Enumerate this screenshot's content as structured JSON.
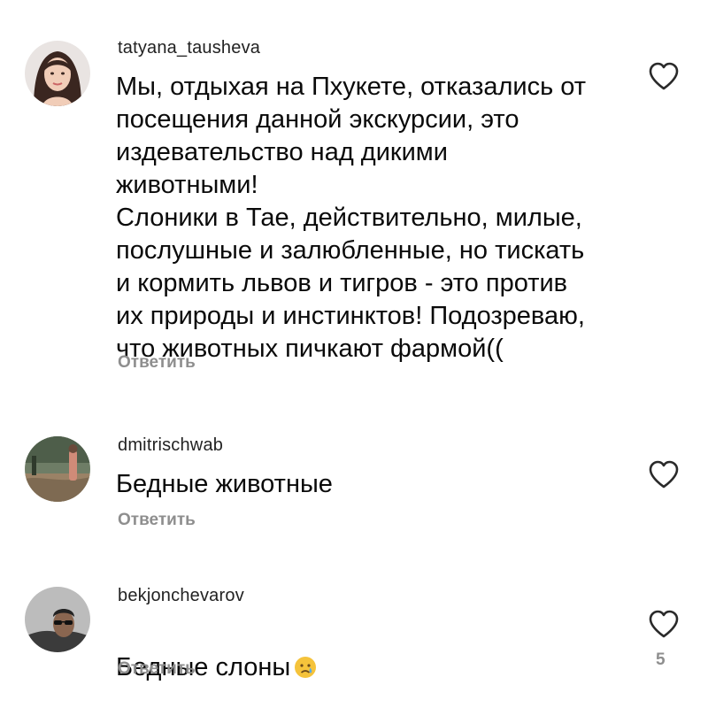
{
  "comments": [
    {
      "username": "tatyana_tausheva",
      "text": "Мы, отдыхая на Пхукете, отказались от\nпосещения данной экскурсии, это\nиздевательство над дикими\nживотными!\nСлоники в Тае, действительно, милые,\nпослушные и залюбленные, но тискать\nи кормить львов и тигров - это против\nих природы и инстинктов! Подозреваю,\nчто животных пичкают фармой((",
      "reply_label": "Ответить",
      "avatar_icon": "user-avatar"
    },
    {
      "username": "dmitrischwab",
      "text": "Бедные животные",
      "reply_label": "Ответить",
      "avatar_icon": "user-avatar"
    },
    {
      "username": "bekjonchevarov",
      "text": "Бедные слоны",
      "emoji": "crying-face",
      "reply_label": "Ответить",
      "like_count": "5",
      "avatar_icon": "user-avatar"
    }
  ],
  "icons": {
    "like": "heart-outline-icon"
  },
  "colors": {
    "text": "#0a0a0a",
    "secondary": "#8e8e8e",
    "background": "#ffffff"
  }
}
